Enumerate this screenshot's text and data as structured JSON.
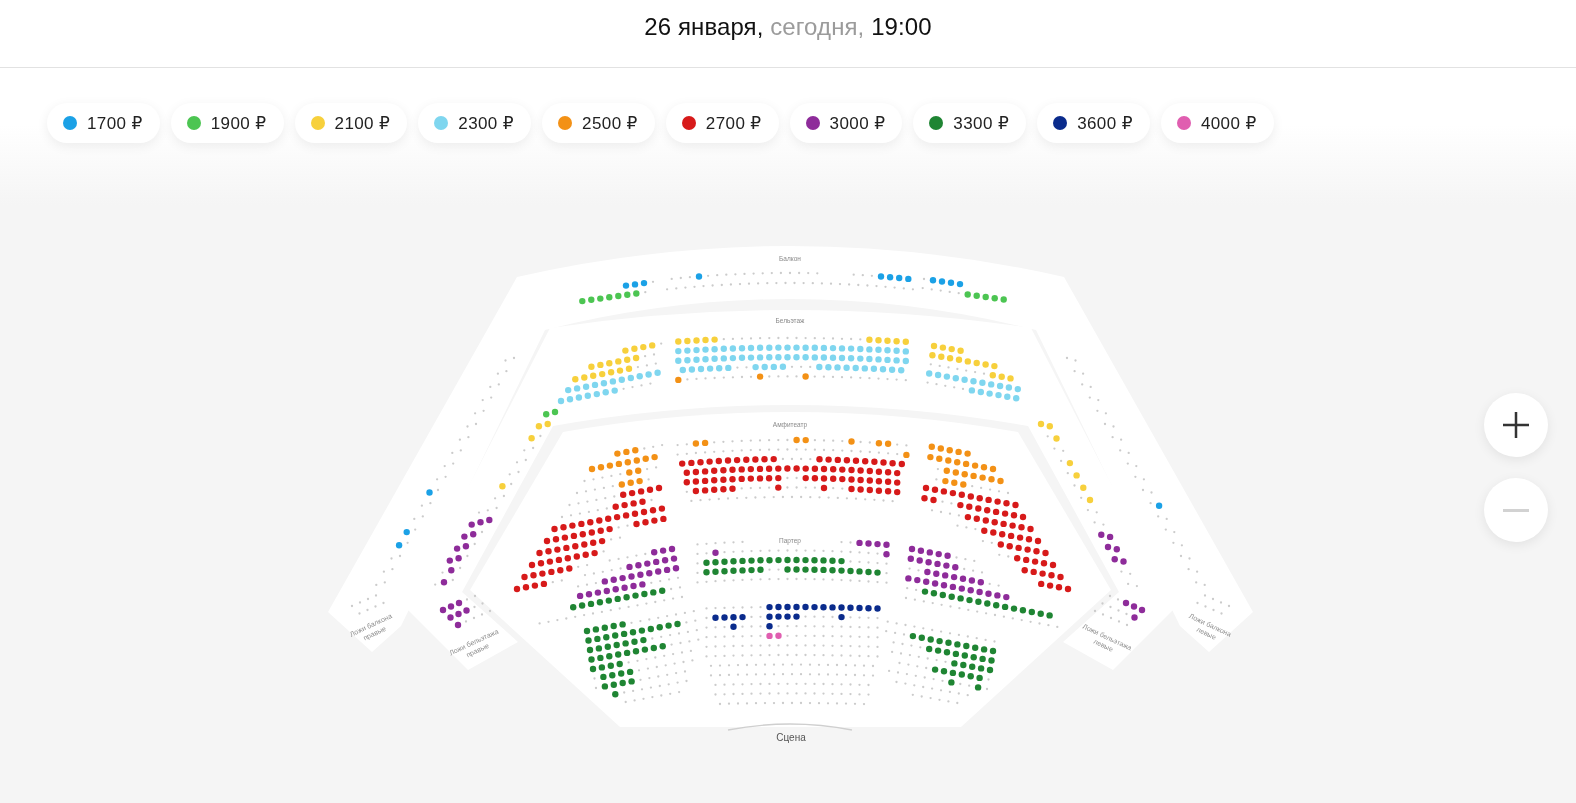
{
  "session": {
    "date": "26 января,",
    "day": "сегодня,",
    "time": "19:00"
  },
  "price_filters": [
    {
      "price": "1700 ₽",
      "color": "#1ba1e6"
    },
    {
      "price": "1900 ₽",
      "color": "#4cc552"
    },
    {
      "price": "2100 ₽",
      "color": "#f7d03c"
    },
    {
      "price": "2300 ₽",
      "color": "#7fd6ef"
    },
    {
      "price": "2500 ₽",
      "color": "#f39116"
    },
    {
      "price": "2700 ₽",
      "color": "#d71a1a"
    },
    {
      "price": "3000 ₽",
      "color": "#8e2c9a"
    },
    {
      "price": "3300 ₽",
      "color": "#1f8533"
    },
    {
      "price": "3600 ₽",
      "color": "#0a2b8c"
    },
    {
      "price": "4000 ₽",
      "color": "#e05eb0"
    }
  ],
  "hall": {
    "sections": [
      {
        "label": "Балкон",
        "kind": "tier"
      },
      {
        "label": "Бельэтаж",
        "kind": "tier"
      },
      {
        "label": "Амфитеатр",
        "kind": "tier"
      },
      {
        "label": "Партер",
        "kind": "tier"
      },
      {
        "label": "Ложи балкона правые",
        "kind": "loge"
      },
      {
        "label": "Ложи бельэтажа правые",
        "kind": "loge"
      },
      {
        "label": "Ложи бельэтажа левые",
        "kind": "loge"
      },
      {
        "label": "Ложи балкона левые",
        "kind": "loge"
      }
    ],
    "stage": {
      "label": "Сцена"
    }
  },
  "zoom_controls": [
    {
      "kind": "zoom-in",
      "disabled": false
    },
    {
      "kind": "zoom-out",
      "disabled": true
    }
  ]
}
